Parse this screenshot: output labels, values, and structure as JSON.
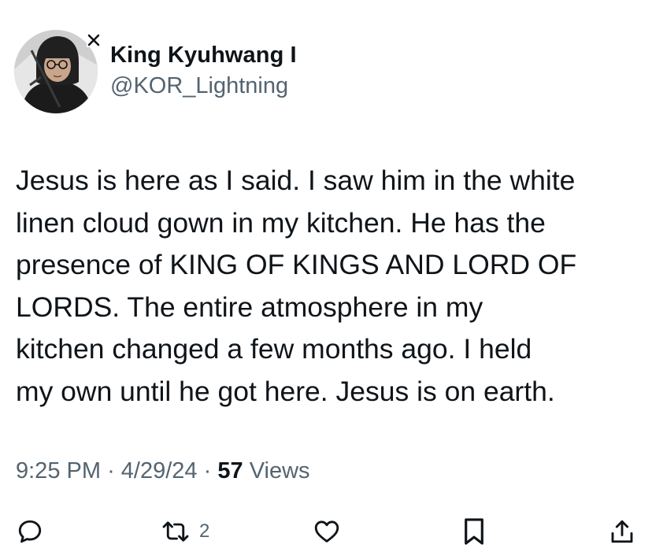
{
  "tweet": {
    "display_name": "King Kyuhwang I",
    "handle": "@KOR_Lightning",
    "body_lines": [
      "Jesus is here as I said. I saw him in the white",
      "linen cloud gown in my kitchen. He has the",
      "presence of KING OF KINGS AND LORD OF",
      "LORDS. The entire atmosphere in my",
      "kitchen changed a few months ago. I held",
      "my own until he got here. Jesus is on earth."
    ],
    "time": "9:25 PM",
    "separator": "·",
    "date": "4/29/24",
    "views_count": "57",
    "views_label": "Views"
  },
  "actions": {
    "reply_icon": "reply-icon",
    "retweet_icon": "retweet-icon",
    "retweet_count": "2",
    "like_icon": "heart-icon",
    "bookmark_icon": "bookmark-icon",
    "share_icon": "share-icon"
  },
  "colors": {
    "text": "#0f1419",
    "secondary": "#536471",
    "background": "#ffffff"
  }
}
